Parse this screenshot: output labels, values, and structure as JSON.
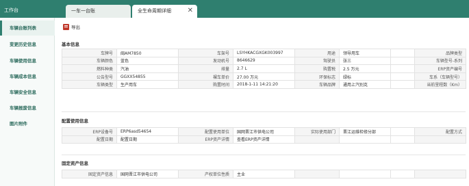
{
  "header": {
    "workbench": "工作台",
    "tabs": [
      {
        "label": "一车一台账"
      },
      {
        "label": "全生命周期详细",
        "close": "✕"
      }
    ]
  },
  "sidebar": {
    "items": [
      {
        "label": "车辆台账列表"
      },
      {
        "label": "变更历史信息"
      },
      {
        "label": "车辆使用信息"
      },
      {
        "label": "车辆成本信息"
      },
      {
        "label": "车辆安全信息"
      },
      {
        "label": "车辆报废信息"
      },
      {
        "label": "图片附件"
      }
    ]
  },
  "toolbar": {
    "export_label": "导出"
  },
  "basic": {
    "title": "基本信息",
    "rows": [
      [
        "车牌号",
        "闽AM7850",
        "车架号",
        "LSYHKACGXGK003997",
        "用途",
        "领导用车",
        "",
        "品牌类型"
      ],
      [
        "车辆颜色",
        "蓝色",
        "发动机号",
        "8646629",
        "驾驶员",
        "张三",
        "",
        "车辆型号-系列"
      ],
      [
        "燃料种类",
        "汽油",
        "排量",
        "2.7 L",
        "购置税",
        "2.5 万元",
        "",
        "ERP资产编号"
      ],
      [
        "公告型号",
        "GGXX54855",
        "裸车单价",
        "27.00 万元",
        "环保标志",
        "绿标",
        "",
        "车系（车辆型号）"
      ],
      [
        "车辆类型",
        "生产用车",
        "购置时间",
        "2018-1-11 14:21:20",
        "车辆品牌",
        "通用上汽别克",
        "",
        "当前里程数（Km）"
      ]
    ]
  },
  "config": {
    "title": "配置使用信息",
    "rows": [
      [
        "ERP设备号",
        "ERP6asd54654",
        "配置使用单位",
        "国网晋江市供电公司",
        "实际使用部门",
        "晋江运维检修分部",
        "",
        "配置方式"
      ],
      [
        "配置日期",
        "配置日期",
        "ERP资产详情",
        "查看ERP资产详情",
        "",
        "",
        "",
        ""
      ]
    ]
  },
  "fixed": {
    "title": "固定资产信息",
    "rows": [
      [
        "固定资产信息",
        "国网晋江市供电公司",
        "产权单位性质",
        "主业",
        "",
        "",
        "",
        ""
      ]
    ]
  }
}
